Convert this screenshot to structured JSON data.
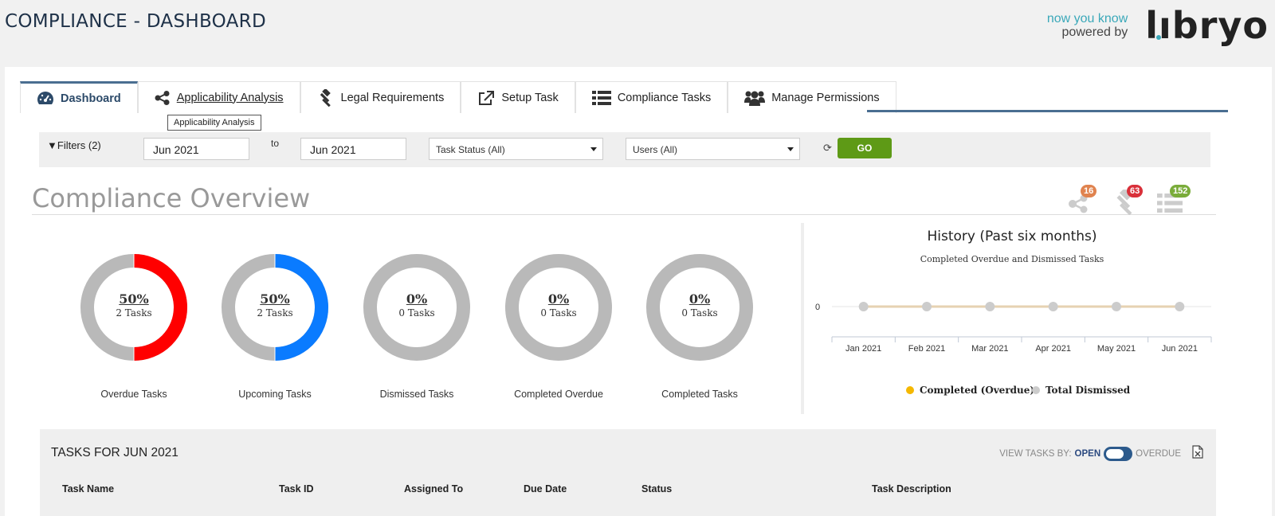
{
  "header": {
    "title": "COMPLIANCE - DASHBOARD",
    "brand_tag_line1": "now you know",
    "brand_tag_line2": "powered by",
    "brand_logo": "lıbryo"
  },
  "tabs": [
    {
      "label": "Dashboard",
      "icon": "tachometer-icon",
      "active": true
    },
    {
      "label": "Applicability Analysis",
      "icon": "share-icon",
      "hover": true
    },
    {
      "label": "Legal Requirements",
      "icon": "gavel-icon"
    },
    {
      "label": "Setup Task",
      "icon": "external-link-icon"
    },
    {
      "label": "Compliance Tasks",
      "icon": "list-icon"
    },
    {
      "label": "Manage Permissions",
      "icon": "users-icon"
    }
  ],
  "tooltip": "Applicability Analysis",
  "filters": {
    "label": "Filters (2)",
    "from": "Jun 2021",
    "to_label": "to",
    "to": "Jun 2021",
    "task_status": "Task Status (All)",
    "users": "Users (All)",
    "go_label": "GO"
  },
  "overview": {
    "title": "Compliance Overview",
    "badges": [
      {
        "icon": "share-icon",
        "count": "16",
        "color": "#e0834f"
      },
      {
        "icon": "gavel-icon",
        "count": "63",
        "color": "#d9303a"
      },
      {
        "icon": "list-icon",
        "count": "152",
        "color": "#7aac3a"
      }
    ],
    "donuts": [
      {
        "pct": "50%",
        "count": "2 Tasks",
        "label": "Overdue Tasks",
        "fraction": 0.5,
        "color": "#ff0000"
      },
      {
        "pct": "50%",
        "count": "2 Tasks",
        "label": "Upcoming Tasks",
        "fraction": 0.5,
        "color": "#0a7bff"
      },
      {
        "pct": "0%",
        "count": "0 Tasks",
        "label": "Dismissed Tasks",
        "fraction": 0,
        "color": "#bbbbbb"
      },
      {
        "pct": "0%",
        "count": "0 Tasks",
        "label": "Completed Overdue",
        "fraction": 0,
        "color": "#bbbbbb"
      },
      {
        "pct": "0%",
        "count": "0 Tasks",
        "label": "Completed Tasks",
        "fraction": 0,
        "color": "#bbbbbb"
      }
    ]
  },
  "chart_data": {
    "type": "line",
    "title": "History (Past six months)",
    "subtitle": "Completed Overdue and Dismissed Tasks",
    "categories": [
      "Jan 2021",
      "Feb 2021",
      "Mar 2021",
      "Apr 2021",
      "May 2021",
      "Jun 2021"
    ],
    "series": [
      {
        "name": "Completed (Overdue)",
        "values": [
          0,
          0,
          0,
          0,
          0,
          0
        ],
        "color": "#f5b800"
      },
      {
        "name": "Total Dismissed",
        "values": [
          0,
          0,
          0,
          0,
          0,
          0
        ],
        "color": "#cccccc"
      }
    ],
    "y_ticks": [
      "0"
    ],
    "legend": "bottom"
  },
  "tasks": {
    "title": "TASKS FOR JUN 2021",
    "view_by_label": "VIEW TASKS BY:",
    "open_label": "OPEN",
    "overdue_label": "OVERDUE",
    "columns": [
      "Task Name",
      "Task ID",
      "Assigned To",
      "Due Date",
      "Status",
      "Task Description"
    ]
  }
}
